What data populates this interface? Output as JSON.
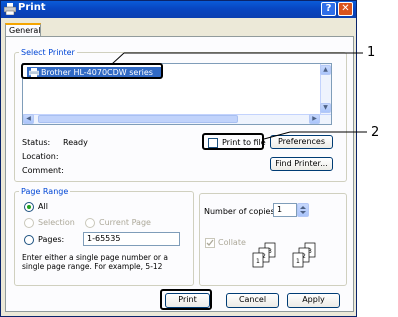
{
  "window": {
    "title": "Print",
    "help": "?",
    "close": "✕"
  },
  "tabs": [
    {
      "label": "General"
    }
  ],
  "select_printer": {
    "legend": "Select Printer",
    "selected_printer": "Brother HL-4070CDW series",
    "status_label": "Status:",
    "status_value": "Ready",
    "location_label": "Location:",
    "comment_label": "Comment:",
    "print_to_file_label": "Print to file",
    "preferences_label": "Preferences",
    "find_printer_label": "Find Printer..."
  },
  "page_range": {
    "legend": "Page Range",
    "all_label": "All",
    "selection_label": "Selection",
    "current_page_label": "Current Page",
    "pages_label": "Pages:",
    "pages_value": "1-65535",
    "hint": "Enter either a single page number or a single page range.  For example, 5-12"
  },
  "copies": {
    "number_label": "Number of copies:",
    "number_value": "1",
    "collate_label": "Collate"
  },
  "buttons": {
    "print": "Print",
    "cancel": "Cancel",
    "apply": "Apply"
  },
  "callouts": {
    "one": "1",
    "two": "2"
  },
  "colors": {
    "title_bar": "#0a5bd8",
    "selection": "#316ac5",
    "group_legend": "#0046d5",
    "window_bg": "#ece9d8"
  },
  "icons": [
    "printer-icon",
    "help-icon",
    "close-icon",
    "collate-pages-icon",
    "spinner-icon"
  ]
}
